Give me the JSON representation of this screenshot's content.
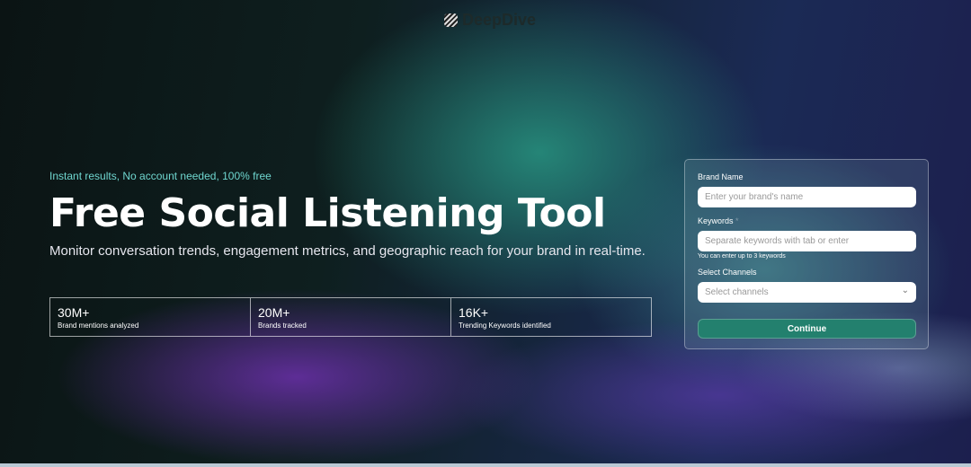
{
  "brand": {
    "name": "DeepDive"
  },
  "hero": {
    "tagline": "Instant results, No account needed, 100% free",
    "title": "Free Social Listening Tool",
    "subtitle": "Monitor conversation trends, engagement metrics, and geographic reach for your brand in real-time."
  },
  "stats": [
    {
      "value": "30M+",
      "label": "Brand mentions analyzed"
    },
    {
      "value": "20M+",
      "label": "Brands tracked"
    },
    {
      "value": "16K+",
      "label": "Trending Keywords identified"
    }
  ],
  "form": {
    "brand_label": "Brand Name",
    "brand_placeholder": "Enter your brand's name",
    "keywords_label": "Keywords",
    "required_mark": "*",
    "keywords_placeholder": "Separate keywords with tab or enter",
    "keywords_hint": "You can enter up to 3 keywords",
    "channels_label": "Select Channels",
    "channels_placeholder": "Select channels",
    "continue": "Continue"
  }
}
